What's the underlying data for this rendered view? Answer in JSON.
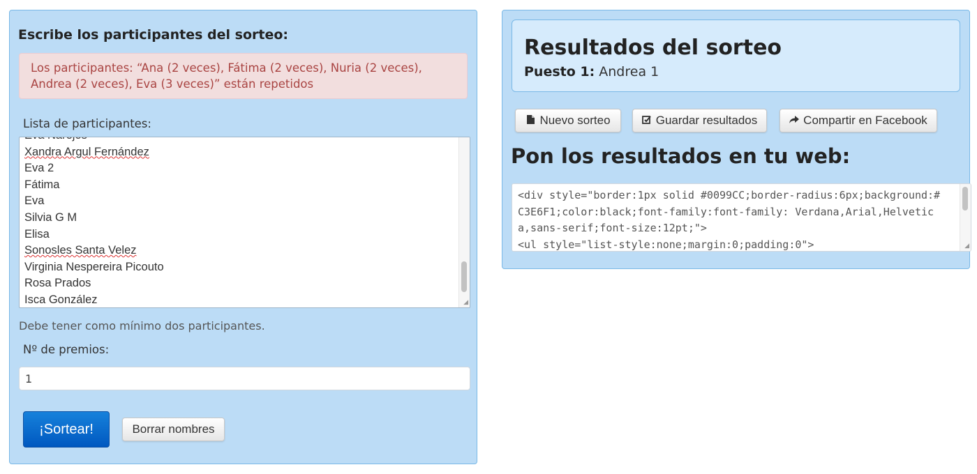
{
  "left": {
    "title": "Escribe los participantes del sorteo:",
    "alert": "Los participantes: “Ana (2 veces), Fátima (2 veces), Nuria (2 veces), Andrea (2 veces), Eva (3 veces)” están repetidos",
    "list_label": "Lista de participantes:",
    "participants": [
      "Eva Narejos",
      "Xandra Argul Fernández",
      "Eva 2",
      "Fátima",
      "Eva",
      "Silvia G M",
      "Elisa",
      "Sonosles Santa Velez",
      "Virginia Nespereira Picouto",
      "Rosa Prados",
      "Isca González"
    ],
    "hint": "Debe tener como mínimo dos participantes.",
    "prizes_label": "Nº de premios:",
    "prizes_value": "1",
    "draw_button": "¡Sortear!",
    "clear_button": "Borrar nombres"
  },
  "right": {
    "results_title": "Resultados del sorteo",
    "result_label": "Puesto 1:",
    "result_value": "Andrea 1",
    "buttons": {
      "new": "Nuevo sorteo",
      "save": "Guardar resultados",
      "share": "Compartir en Facebook"
    },
    "web_title": "Pon los resultados en tu web:",
    "code": "<div style=\"border:1px solid #0099CC;border-radius:6px;background:#C3E6F1;color:black;font-family:font-family: Verdana,Arial,Helvetica,sans-serif;font-size:12pt;\">\n<ul style=\"list-style:none;margin:0;padding:0\">"
  },
  "colors": {
    "panel_bg": "#bcdcf6",
    "panel_border": "#79b8e6",
    "alert_bg": "#f2dede",
    "alert_text": "#a94442",
    "primary_button": "#0a6fd0"
  },
  "icons": {
    "new": "file-icon",
    "save": "edit-check-icon",
    "share": "share-arrow-icon"
  }
}
